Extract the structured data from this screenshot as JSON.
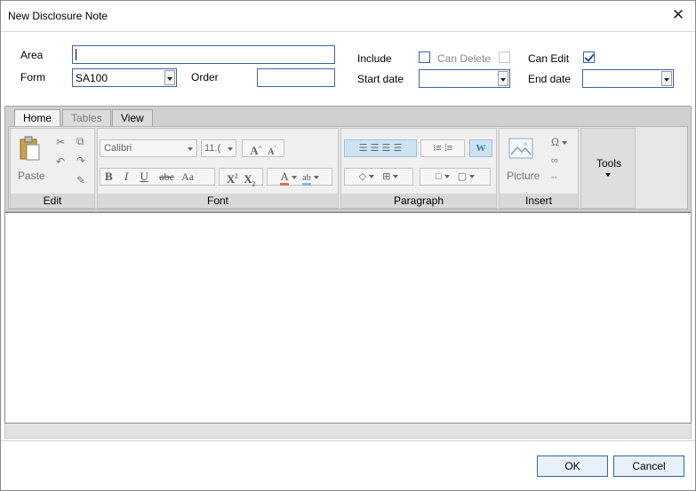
{
  "window": {
    "title": "New Disclosure Note"
  },
  "form": {
    "area_label": "Area",
    "area_value": "",
    "form_label": "Form",
    "form_value": "SA100",
    "order_label": "Order",
    "order_value": "",
    "include_label": "Include",
    "can_delete_label": "Can Delete",
    "can_edit_label": "Can Edit",
    "start_date_label": "Start date",
    "end_date_label": "End date",
    "include_checked": false,
    "can_delete_checked": false,
    "can_edit_checked": true
  },
  "ribbon": {
    "tabs": [
      {
        "label": "Home"
      },
      {
        "label": "Tables"
      },
      {
        "label": "View"
      }
    ],
    "groups": {
      "edit": {
        "label": "Edit",
        "paste_label": "Paste"
      },
      "font": {
        "label": "Font",
        "font_name": "Calibri",
        "font_size": "11.("
      },
      "paragraph": {
        "label": "Paragraph"
      },
      "insert": {
        "label": "Insert",
        "picture_label": "Picture"
      },
      "tools": {
        "label": "Tools"
      }
    }
  },
  "footer": {
    "ok_label": "OK",
    "cancel_label": "Cancel"
  },
  "colors": {
    "accent_border": "#3a64a8",
    "button_border": "#2f66b0"
  }
}
